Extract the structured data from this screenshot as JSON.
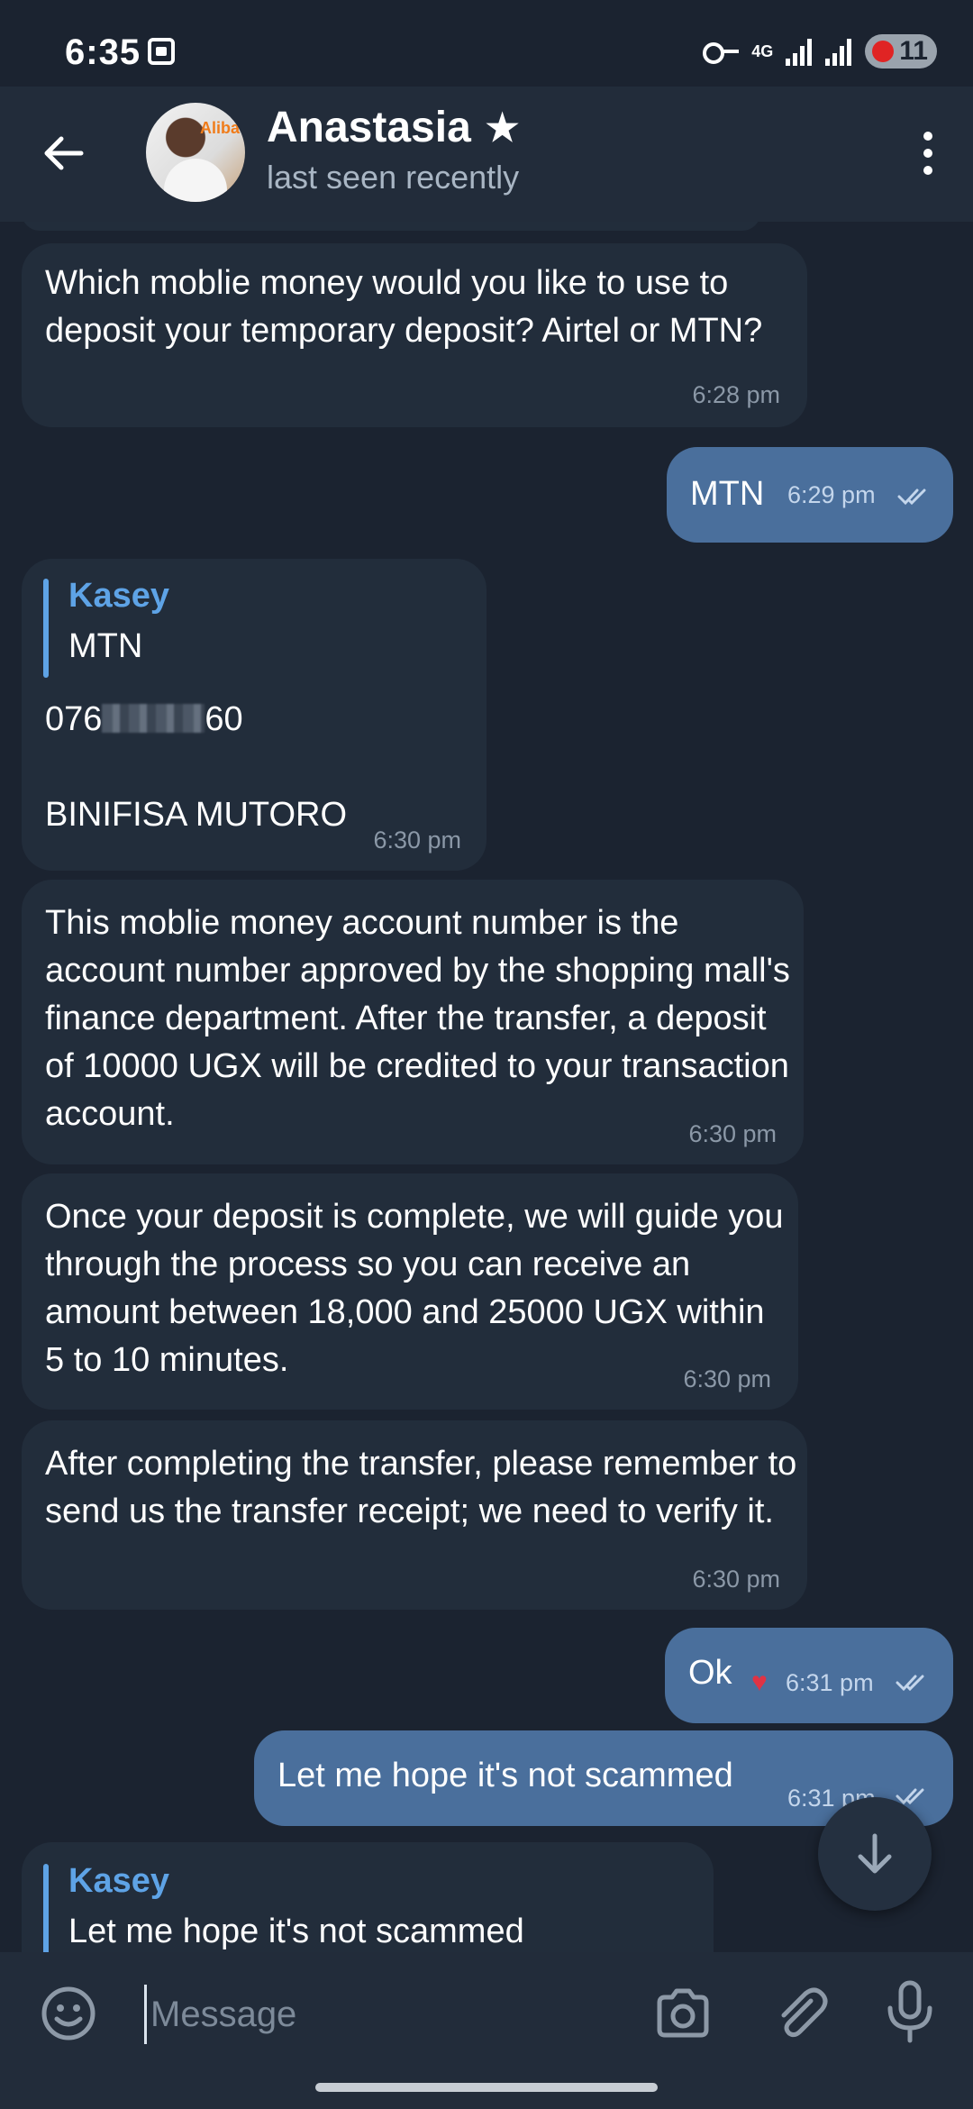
{
  "status_bar": {
    "time": "6:35",
    "network": "4G",
    "battery": "11"
  },
  "header": {
    "contact_name": "Anastasia",
    "status": "last seen recently",
    "avatar_logo_text": "Aliba"
  },
  "messages": [
    {
      "dir": "in",
      "text": "Which moblie money would you like to use to deposit your temporary deposit? Airtel or MTN?",
      "time": "6:28 pm"
    },
    {
      "dir": "out",
      "text": "MTN",
      "time": "6:29 pm",
      "read": true
    },
    {
      "dir": "in",
      "reply_to_name": "Kasey",
      "reply_to_text": "MTN",
      "number_start": "076",
      "number_end": "60",
      "name": "BINIFISA MUTORO",
      "time": "6:30 pm"
    },
    {
      "dir": "in",
      "text": "This moblie money account number is the account number approved by the shopping mall's finance department. After the transfer, a deposit of 10000 UGX will be credited to your transaction account.",
      "time": "6:30 pm"
    },
    {
      "dir": "in",
      "text": "Once your deposit is complete, we will guide you through the process so you can receive an amount between 18,000 and 25000 UGX within 5 to 10 minutes.",
      "time": "6:30 pm"
    },
    {
      "dir": "in",
      "text": "After completing the transfer, please remember to send us the transfer receipt; we need to verify it.",
      "time": "6:30 pm"
    },
    {
      "dir": "out",
      "text": "Ok",
      "time": "6:31 pm",
      "reaction": "heart",
      "read": true
    },
    {
      "dir": "out",
      "text": "Let me hope it's not scammed",
      "time": "6:31 pm",
      "read": true
    },
    {
      "dir": "in",
      "reply_to_name": "Kasey",
      "reply_to_text": "Let me hope it's not scammed"
    }
  ],
  "composer": {
    "placeholder": "Message"
  },
  "colors": {
    "background": "#1b2330",
    "header": "#222c3a",
    "incoming_bubble": "#222d3b",
    "outgoing_bubble": "#4a6f9c",
    "accent": "#5ea3e6"
  },
  "icons": [
    "back-arrow-icon",
    "star-icon",
    "more-vertical-icon",
    "emoji-icon",
    "camera-icon",
    "paperclip-icon",
    "microphone-icon",
    "arrow-down-icon",
    "double-check-icon",
    "heart-icon"
  ]
}
